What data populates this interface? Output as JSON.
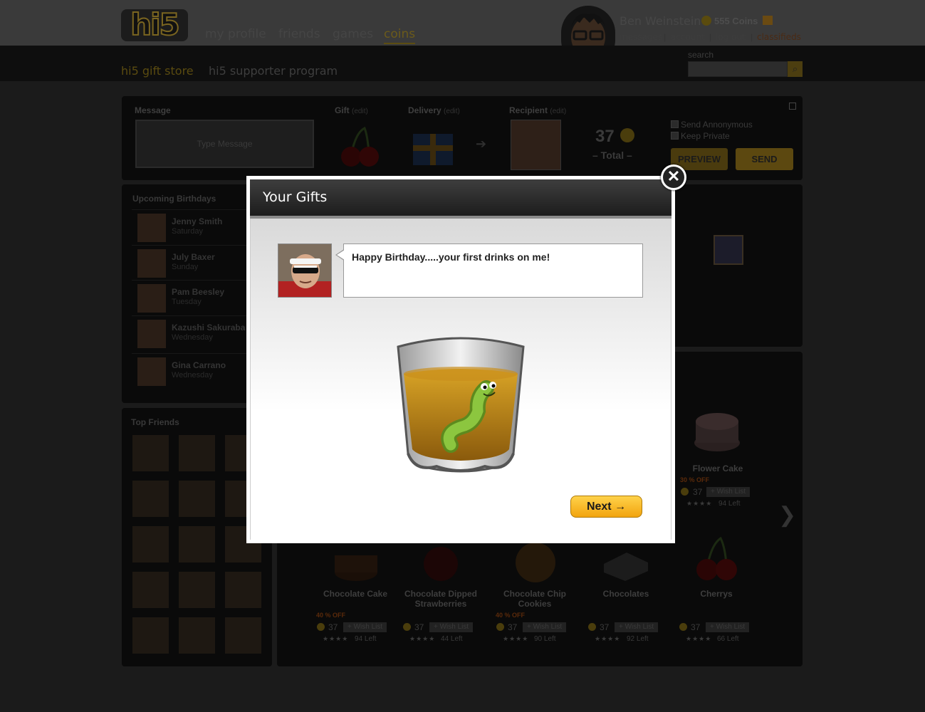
{
  "header": {
    "logo_text": "hi5",
    "nav": [
      "my profile",
      "friends",
      "games",
      "coins"
    ],
    "username": "Ben Weinstein",
    "coins": "555 Coins",
    "links": [
      "messages",
      "account",
      "log out",
      "classifieds"
    ],
    "search_label": "search"
  },
  "subnav": {
    "items": [
      "hi5 gift store",
      "hi5 supporter program"
    ]
  },
  "composer": {
    "message_label": "Message",
    "message_placeholder": "Type Message",
    "gift_label": "Gift",
    "delivery_label": "Delivery",
    "recipient_label": "Recipient",
    "edit": "(edit)",
    "total_value": "37",
    "total_label": "– Total –",
    "send_anonymous": "Send Annonymous",
    "keep_private": "Keep Private",
    "preview": "PREVIEW",
    "send": "SEND"
  },
  "birthdays": {
    "title": "Upcoming Birthdays",
    "items": [
      {
        "name": "Jenny Smith",
        "day": "Saturday"
      },
      {
        "name": "July Baxer",
        "day": "Sunday"
      },
      {
        "name": "Pam Beesley",
        "day": "Tuesday"
      },
      {
        "name": "Kazushi Sakuraba",
        "day": "Wednesday"
      },
      {
        "name": "Gina Carrano",
        "day": "Wednesday"
      }
    ]
  },
  "top_friends": {
    "title": "Top Friends"
  },
  "gifts": {
    "row1": [
      {
        "name": "Flower Cake",
        "sale": "30 % OFF",
        "price": "37",
        "wish": "+ Wish List",
        "left": "94 Left"
      }
    ],
    "row2": [
      {
        "name": "Chocolate Cake",
        "sale": "40 % OFF",
        "price": "37",
        "wish": "+ Wish List",
        "left": "94 Left"
      },
      {
        "name": "Chocolate Dipped Strawberries",
        "sale": "",
        "price": "37",
        "wish": "+ Wish List",
        "left": "44 Left"
      },
      {
        "name": "Chocolate Chip Cookies",
        "sale": "40 % OFF",
        "price": "37",
        "wish": "+ Wish List",
        "left": "90 Left"
      },
      {
        "name": "Chocolates",
        "sale": "",
        "price": "37",
        "wish": "+ Wish List",
        "left": "92 Left"
      },
      {
        "name": "Cherrys",
        "sale": "",
        "price": "37",
        "wish": "+ Wish List",
        "left": "66 Left"
      }
    ]
  },
  "modal": {
    "title": "Your Gifts",
    "message": "Happy Birthday.....your first drinks on me!",
    "next": "Next →",
    "close": "✕"
  }
}
